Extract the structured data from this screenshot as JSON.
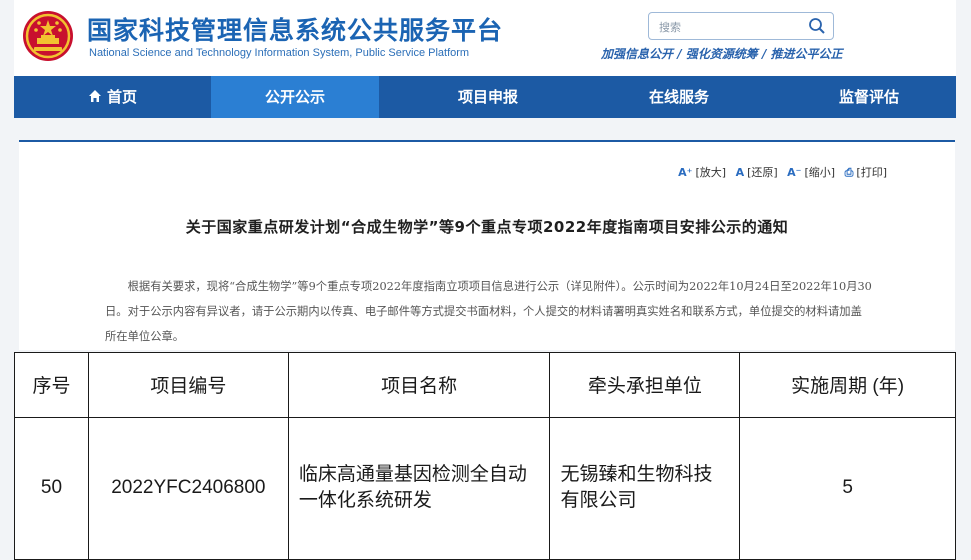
{
  "header": {
    "title": "国家科技管理信息系统公共服务平台",
    "subtitle": "National Science and Technology Information System, Public Service Platform",
    "search_placeholder": "搜索",
    "slogan": "加强信息公开 / 强化资源统筹 / 推进公平公正"
  },
  "nav": {
    "items": [
      {
        "label": "首页",
        "icon": "home-icon",
        "active": false
      },
      {
        "label": "公开公示",
        "active": true
      },
      {
        "label": "项目申报",
        "active": false
      },
      {
        "label": "在线服务",
        "active": false
      },
      {
        "label": "监督评估",
        "active": false
      }
    ]
  },
  "tools": {
    "zoom_in": "[放大]",
    "reset": "[还原]",
    "zoom_out": "[缩小]",
    "print": "[打印]"
  },
  "article": {
    "title": "关于国家重点研发计划“合成生物学”等9个重点专项2022年度指南项目安排公示的通知",
    "body": "根据有关要求，现将“合成生物学”等9个重点专项2022年度指南立项项目信息进行公示（详见附件）。公示时间为2022年10月24日至2022年10月30日。对于公示内容有异议者，请于公示期内以传真、电子邮件等方式提交书面材料，个人提交的材料请署明真实姓名和联系方式，单位提交的材料请加盖所在单位公章。"
  },
  "table": {
    "headers": [
      "序号",
      "项目编号",
      "项目名称",
      "牵头承担单位",
      "实施周期  (年)"
    ],
    "rows": [
      [
        "50",
        "2022YFC2406800",
        "临床高通量基因检测全自动一体化系统研发",
        "无锡臻和生物科技有限公司",
        "5"
      ]
    ]
  },
  "colors": {
    "brand_blue": "#1b64b3",
    "nav_bg": "#1c5aa4",
    "nav_active": "#2b7fd3"
  }
}
